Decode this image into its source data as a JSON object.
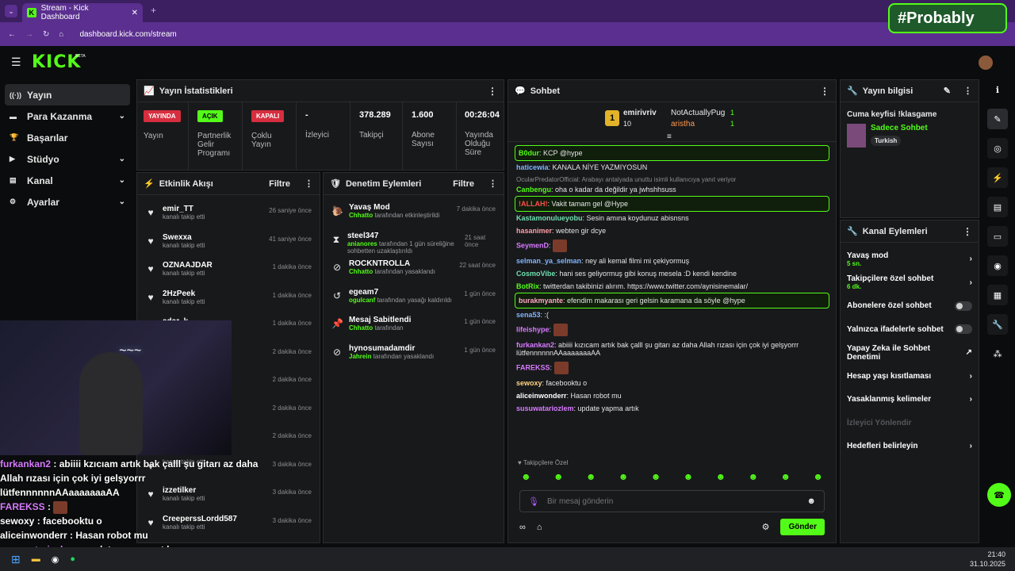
{
  "browser": {
    "tab_title": "Stream - Kick Dashboard",
    "url": "dashboard.kick.com/stream",
    "overlay_badge": "#Probably"
  },
  "brand": {
    "logo": "KICK",
    "beta": "BETA",
    "accent": "#53fc18"
  },
  "sidebar": {
    "items": [
      {
        "label": "Yayın",
        "icon": "broadcast-icon",
        "active": true
      },
      {
        "label": "Para Kazanma",
        "icon": "money-icon",
        "chev": true
      },
      {
        "label": "Başarılar",
        "icon": "trophy-icon"
      },
      {
        "label": "Stüdyo",
        "icon": "video-icon",
        "chev": true
      },
      {
        "label": "Kanal",
        "icon": "channel-icon",
        "chev": true
      },
      {
        "label": "Ayarlar",
        "icon": "gear-icon",
        "chev": true
      }
    ]
  },
  "stats": {
    "title": "Yayın İstatistikleri",
    "cells": [
      {
        "badge": "YAYINDA",
        "label": "Yayın"
      },
      {
        "badge": "AÇIK",
        "label": "Partnerlik Gelir Programı"
      },
      {
        "badge": "KAPALI",
        "label": "Çoklu Yayın"
      },
      {
        "value": "-",
        "label": "İzleyici"
      },
      {
        "value": "378.289",
        "label": "Takipçi"
      },
      {
        "value": "1.600",
        "label": "Abone Sayısı"
      },
      {
        "value": "00:26:04",
        "label": "Yayında Olduğu Süre"
      }
    ]
  },
  "activity": {
    "title": "Etkinlik Akışı",
    "filter": "Filtre",
    "rows": [
      {
        "name": "emir_TT",
        "sub": "kanalı takip etti",
        "time": "26 saniye önce"
      },
      {
        "name": "Swexxa",
        "sub": "kanalı takip etti",
        "time": "41 saniye önce"
      },
      {
        "name": "OZNAAJDAR",
        "sub": "kanalı takip etti",
        "time": "1 dakika önce"
      },
      {
        "name": "2HzPeek",
        "sub": "kanalı takip etti",
        "time": "1 dakika önce"
      },
      {
        "name": "adar_k",
        "sub": "",
        "time": "1 dakika önce"
      },
      {
        "name": "",
        "sub": "",
        "time": "2 dakika önce"
      },
      {
        "name": "",
        "sub": "",
        "time": "2 dakika önce"
      },
      {
        "name": "",
        "sub": "",
        "time": "2 dakika önce"
      },
      {
        "name": "",
        "sub": "",
        "time": "2 dakika önce"
      },
      {
        "name": "",
        "sub": "kanalı takip etti",
        "time": "3 dakika önce"
      },
      {
        "name": "izzetilker",
        "sub": "kanalı takip etti",
        "time": "3 dakika önce"
      },
      {
        "name": "CreeperssLordd587",
        "sub": "kanalı takip etti",
        "time": "3 dakika önce"
      }
    ]
  },
  "moderation": {
    "title": "Denetim Eylemleri",
    "filter": "Filtre",
    "rows": [
      {
        "icon": "snail-icon",
        "name": "Yavaş Mod",
        "actor": "Chhatto",
        "sub": "tarafından etkinleştirildi",
        "time": "7 dakika önce"
      },
      {
        "icon": "hourglass-icon",
        "name": "steel347",
        "actor": "anianores",
        "sub": "tarafından 1 gün süreliğine sohbetten uzaklaştırıldı",
        "time": "21 saat önce"
      },
      {
        "icon": "ban-icon",
        "name": "ROCKNTROLLA",
        "actor": "Chhatto",
        "sub": "tarafından yasaklandı",
        "time": "22 saat önce"
      },
      {
        "icon": "undo-icon",
        "name": "egeam7",
        "actor": "ogulcanf",
        "sub": "tarafından yasağı kaldırıldı",
        "time": "1 gün önce"
      },
      {
        "icon": "pin-icon",
        "name": "Mesaj Sabitlendi",
        "actor": "Chhatto",
        "sub": "tarafından",
        "time": "1 gün önce"
      },
      {
        "icon": "ban-icon",
        "name": "hynosumadamdir",
        "actor": "Jahrein",
        "sub": "tarafından yasaklandı",
        "time": "1 gün önce"
      }
    ]
  },
  "chat": {
    "title": "Sohbet",
    "top": {
      "rank": "1",
      "user1": "emirivriv",
      "user1_val": "10",
      "user2": "NotActuallyPug",
      "user2_val": "1",
      "user3": "aristha",
      "user3_val": "1"
    },
    "messages": [
      {
        "user": "B0dur",
        "color": "#53fc18",
        "text": "KCP @hype",
        "hl": true
      },
      {
        "user": "haticewia",
        "color": "#7fb6ff",
        "text": "KANALA NİYE YAZMIYOSUN"
      },
      {
        "reply": "OcularPredatorOfficial: Arabayı antalyada unuttu isimli kullanıcıya yanıt veriyor",
        "user": "Canbengu",
        "color": "#53fc18",
        "text": "oha o kadar da değildir ya jwhshhsuss"
      },
      {
        "user": "!ALLAH!",
        "color": "#ff4d4d",
        "text": "Vakit tamam gel @Hype",
        "hl": true
      },
      {
        "user": "Kastamonulueyobu",
        "color": "#6fe0b0",
        "text": "Sesin amına koydunuz abisnsns"
      },
      {
        "user": "hasanimer",
        "color": "#ff9fa8",
        "text": "webten gir dcye"
      },
      {
        "user": "SeymenD",
        "color": "#d77bff",
        "text": ""
      },
      {
        "user": "selman_ya_selman",
        "color": "#7fb6ff",
        "text": "ney ali kemal filmi mi çekiyormuş"
      },
      {
        "user": "CosmoVibe",
        "color": "#6fe0b0",
        "text": "hani ses geliyormuş gibi konuş mesela :D kendi kendine"
      },
      {
        "user": "BotRix",
        "color": "#53fc18",
        "text": "twitterdan takibinizi alırım. https://www.twitter.com/aynisinemalar/"
      },
      {
        "user": "burakmyante",
        "color": "#ffa5c8",
        "text": "efendim makarası geri gelsin karamana da söyle @hype",
        "hl": true
      },
      {
        "user": "sena53",
        "color": "#7fb6ff",
        "text": ":("
      },
      {
        "user": "lifeishype",
        "color": "#d77bff",
        "text": ""
      },
      {
        "user": "furkankan2",
        "color": "#d77bff",
        "text": "abiiii kızıcam artık bak çalll şu gitarı az daha Allah rızası için çok iyi gelşyorrr lütfennnnnnAAaaaaaaaAA"
      },
      {
        "user": "FAREKSS",
        "color": "#d77bff",
        "text": ""
      },
      {
        "user": "sewoxy",
        "color": "#ffd27f",
        "text": "facebooktu o"
      },
      {
        "user": "aliceinwonderr",
        "color": "#fff",
        "text": "Hasan robot mu"
      },
      {
        "user": "susuwatariozlem",
        "color": "#d77bff",
        "text": "update yapma artık"
      }
    ],
    "follower_label": "Takipçilere Özel",
    "placeholder": "Bir mesaj gönderin",
    "send": "Gönder"
  },
  "streaminfo": {
    "title": "Yayın bilgisi",
    "stream_title": "Cuma keyfisi !klasgame",
    "category": "Sadece Sohbet",
    "tag": "Turkish"
  },
  "channel_actions": {
    "title": "Kanal Eylemleri",
    "items": [
      {
        "label": "Yavaş mod",
        "sub": "5 sn.",
        "type": "arrow"
      },
      {
        "label": "Takipçilere özel sohbet",
        "sub": "6 dk.",
        "type": "arrow"
      },
      {
        "label": "Abonelere özel sohbet",
        "type": "toggle"
      },
      {
        "label": "Yalnızca ifadelerle sohbet",
        "type": "toggle"
      },
      {
        "label": "Yapay Zeka ile Sohbet Denetimi",
        "type": "ext"
      },
      {
        "label": "Hesap yaşı kısıtlaması",
        "type": "arrow"
      },
      {
        "label": "Yasaklanmış kelimeler",
        "type": "arrow"
      },
      {
        "label": "İzleyici Yönlendir",
        "type": "disabled"
      },
      {
        "label": "Hedefleri belirleyin",
        "type": "arrow"
      }
    ]
  },
  "overlay": {
    "lines": [
      {
        "user": "furkankan2",
        "color": "#d77bff",
        "text": "abiiii kzıcıam artık bak çalll şu gitarı az daha Allah rızası için çok iyi gelşyorrr lütfennnnnnAAaaaaaaaAA"
      },
      {
        "user": "FAREKSS",
        "color": "#d77bff",
        "text": ""
      },
      {
        "user": "sewoxy",
        "color": "#fff",
        "text": "facebooktu o"
      },
      {
        "user": "aliceinwonderr",
        "color": "#fff",
        "text": "Hasan robot mu"
      },
      {
        "user": "susuwatariozlem",
        "color": "#d77bff",
        "text": "update yapma artık"
      }
    ]
  },
  "taskbar": {
    "time": "21:40",
    "date": "31.10.2025"
  }
}
